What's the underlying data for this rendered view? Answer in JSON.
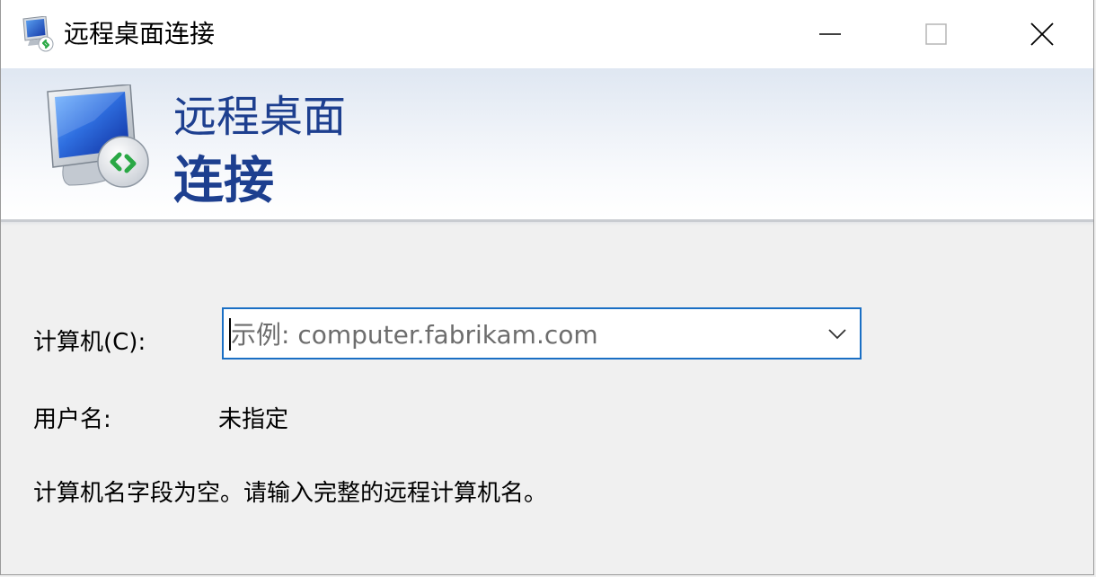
{
  "window": {
    "title": "远程桌面连接",
    "controls": {
      "minimize_icon": "minimize-icon",
      "maximize_icon": "maximize-icon",
      "close_icon": "close-icon"
    }
  },
  "banner": {
    "line1": "远程桌面",
    "line2": "连接",
    "icon": "remote-desktop-monitor-icon"
  },
  "form": {
    "computer_label": "计算机(C):",
    "computer_placeholder": "示例: computer.fabrikam.com",
    "computer_value": "",
    "username_label": "用户名:",
    "username_value": "未指定",
    "message": "计算机名字段为空。请输入完整的远程计算机名。"
  },
  "colors": {
    "title_blue": "#1d3f8f",
    "focus_border": "#1a6fc4",
    "background": "#f0f0f0"
  }
}
